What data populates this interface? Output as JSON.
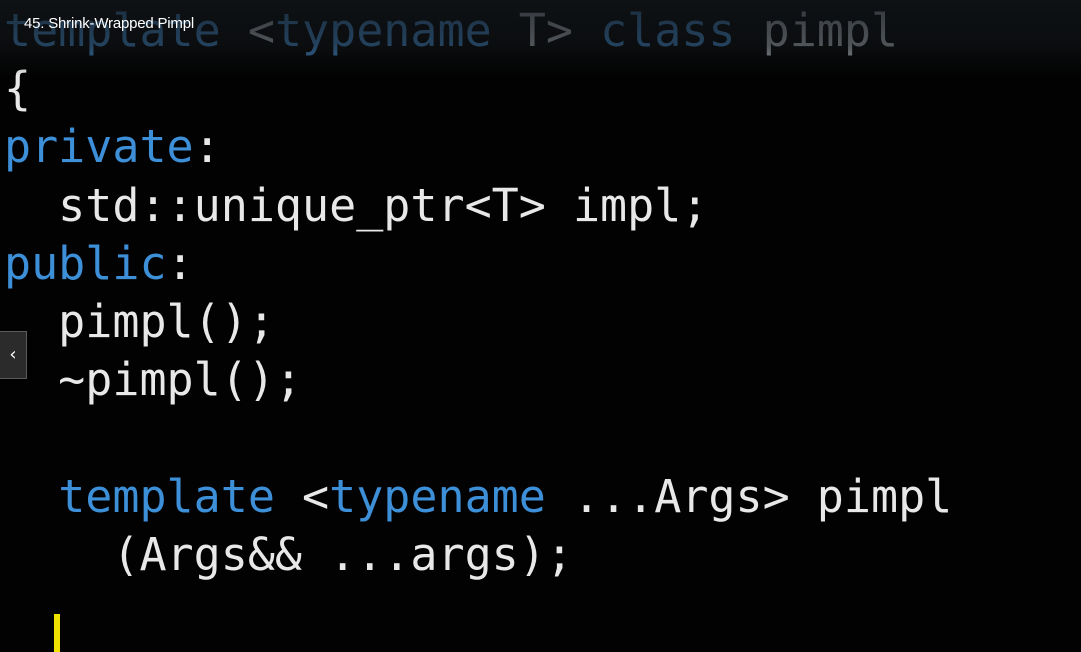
{
  "video": {
    "title": "45. Shrink-Wrapped Pimpl"
  },
  "nav": {
    "back_icon": "chevron-left-icon",
    "back_glyph": "‹"
  },
  "code": {
    "line1": {
      "kw1": "template",
      "sp1": " ",
      "punct1": "<",
      "kw2": "typename",
      "rest": " T> ",
      "kw3": "class",
      "tail": " pimpl"
    },
    "line2": "{",
    "line3": {
      "kw": "private",
      "punct": ":"
    },
    "line4": "  std::unique_ptr<T> impl;",
    "line5": {
      "kw": "public",
      "punct": ":"
    },
    "line6": "  pimpl();",
    "line7": "  ~pimpl();",
    "line8": "",
    "line9": {
      "indent": "  ",
      "kw1": "template",
      "sp": " <",
      "kw2": "typename",
      "tail": " ...Args> pimpl"
    },
    "line10": "    (Args&& ...args);"
  },
  "colors": {
    "keyword": "#3d8fd8",
    "text": "#e8e8e8",
    "cursor": "#f0e000",
    "background": "#020202"
  }
}
